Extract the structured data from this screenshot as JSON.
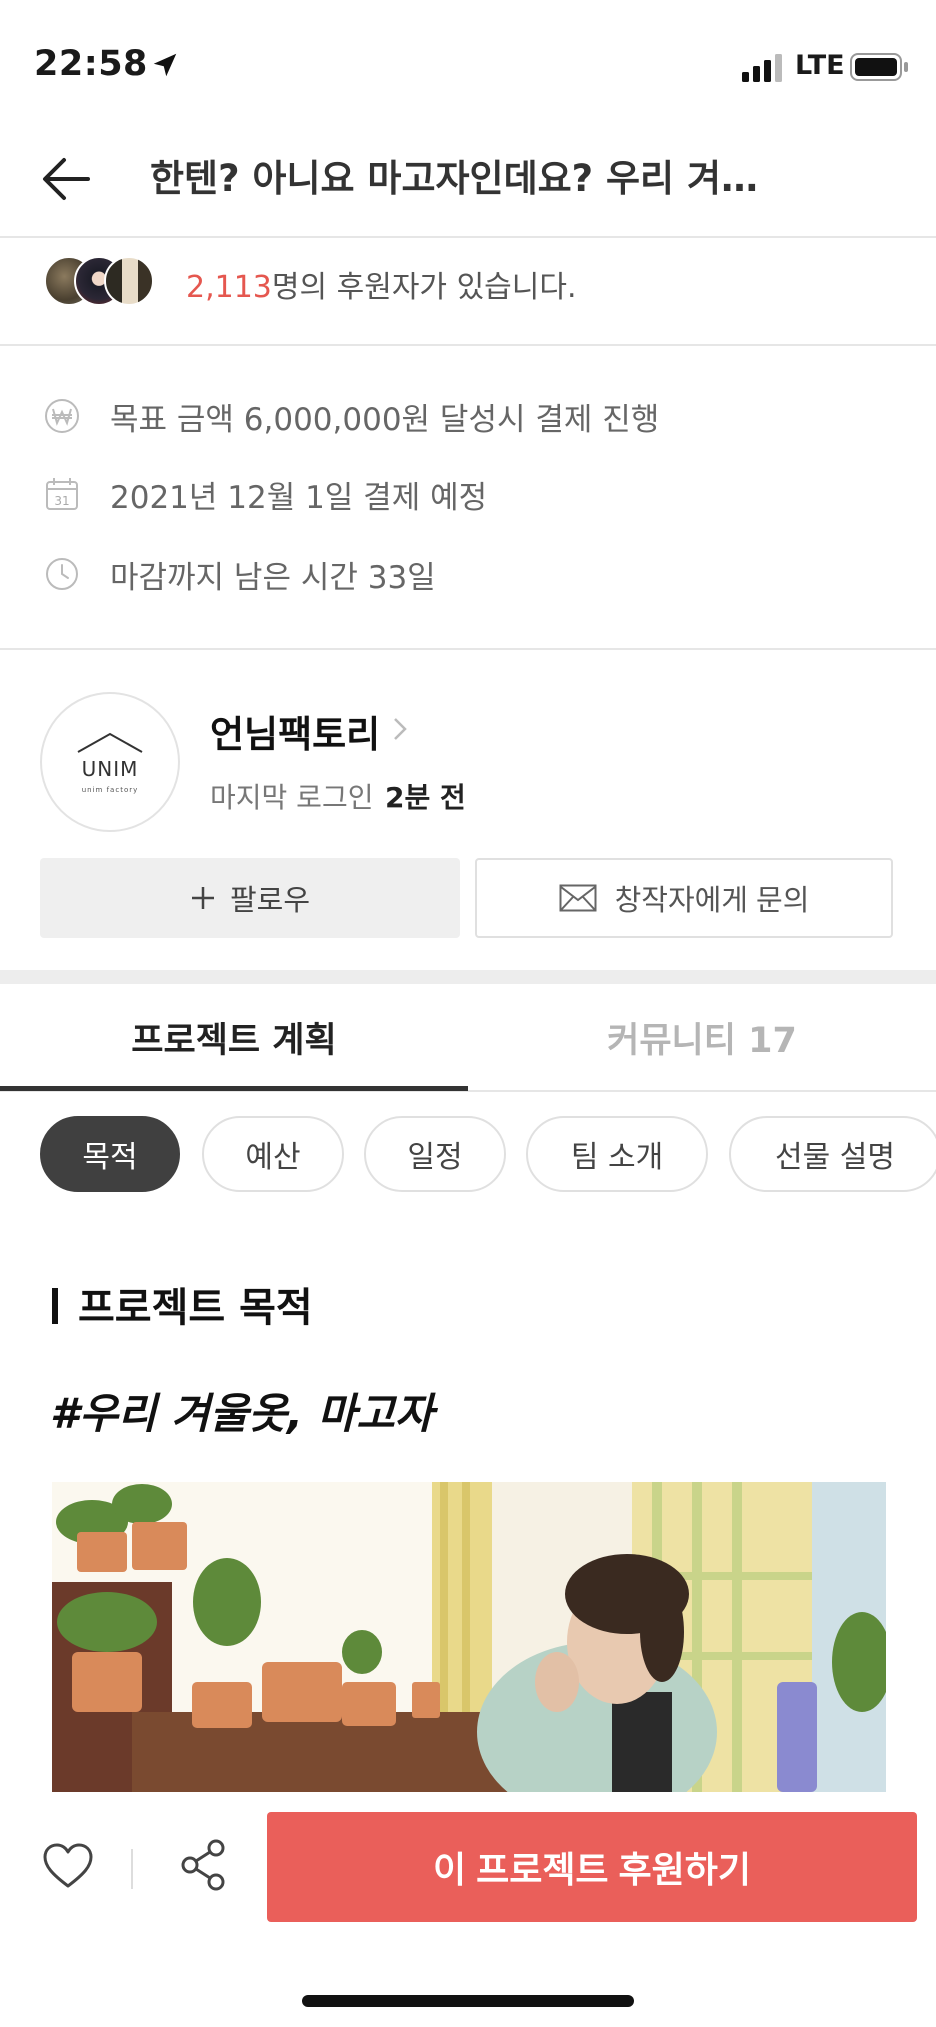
{
  "status_bar": {
    "time": "22:58",
    "network": "LTE",
    "icons": [
      "location-arrow-icon",
      "signal-icon",
      "battery-icon"
    ]
  },
  "header": {
    "title": "한텐? 아니요 마고자인데요? 우리 겨…",
    "back_icon": "back-arrow-icon"
  },
  "supporters": {
    "count": "2,113",
    "suffix": "명의 후원자가 있습니다."
  },
  "info": {
    "goal": "목표 금액 6,000,000원 달성시 결제 진행",
    "payment_date": "2021년 12월 1일 결제 예정",
    "remaining": "마감까지 남은 시간 33일",
    "calendar_day": "31"
  },
  "creator": {
    "name": "언님팩토리",
    "last_login_label": "마지막 로그인",
    "last_login_time": "2분 전",
    "logo_text": "UNIM",
    "logo_sub": "unim factory",
    "follow_label": "팔로우",
    "contact_label": "창작자에게 문의"
  },
  "tabs": [
    {
      "label": "프로젝트 계획",
      "active": true
    },
    {
      "label": "커뮤니티 17",
      "active": false
    }
  ],
  "chips": [
    {
      "label": "목적",
      "active": true
    },
    {
      "label": "예산",
      "active": false
    },
    {
      "label": "일정",
      "active": false
    },
    {
      "label": "팀 소개",
      "active": false
    },
    {
      "label": "선물 설명",
      "active": false
    }
  ],
  "content": {
    "heading": "프로젝트 목적",
    "hashtag": "#우리 겨울옷, 마고자"
  },
  "bottom_bar": {
    "support_label": "이 프로젝트 후원하기"
  },
  "colors": {
    "accent": "#ea5f5a",
    "count_red": "#e5574f",
    "chip_active": "#404040"
  }
}
